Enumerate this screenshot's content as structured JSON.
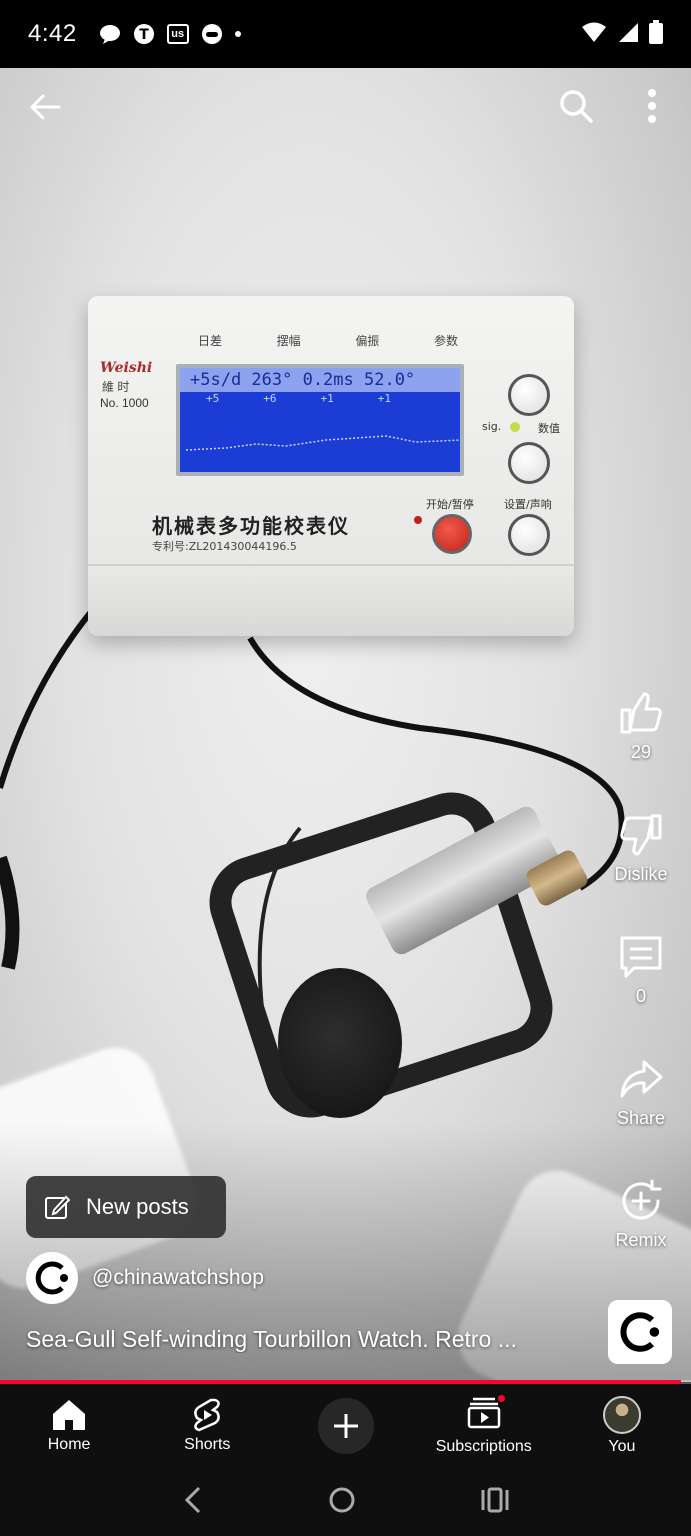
{
  "status_bar": {
    "time": "4:42",
    "carrier_badge": "T",
    "us_badge": "us"
  },
  "video": {
    "device": {
      "brand": "Weishi",
      "brand_cn": "維 时",
      "model": "No. 1000",
      "col_labels": [
        "日差",
        "摆幅",
        "偏振",
        "参数"
      ],
      "lcd_readout": "+5s/d 263° 0.2ms 52.0°",
      "lcd_sub": [
        "+5",
        "+6",
        "+1",
        "+1"
      ],
      "sig_label": "sig.",
      "value_label": "数值",
      "start_label": "开始/暂停",
      "settings_label": "设置/声响",
      "title": "机械表多功能校表仪",
      "patent": "专利号:ZL201430044196.5"
    }
  },
  "rail": {
    "like_count": "29",
    "dislike_label": "Dislike",
    "comments_count": "0",
    "share_label": "Share",
    "remix_label": "Remix"
  },
  "overlay": {
    "new_posts_label": "New posts",
    "channel_handle": "@chinawatchshop",
    "video_title": "Sea-Gull Self-winding Tourbillon Watch. Retro ..."
  },
  "progress": {
    "fraction": 0.985
  },
  "nav": {
    "items": [
      {
        "label": "Home",
        "icon": "home-icon"
      },
      {
        "label": "Shorts",
        "icon": "shorts-icon"
      },
      {
        "label": "",
        "icon": "create-icon"
      },
      {
        "label": "Subscriptions",
        "icon": "subscriptions-icon"
      },
      {
        "label": "You",
        "icon": "avatar"
      }
    ]
  },
  "colors": {
    "accent": "#ff0033",
    "nav_bg": "#0f0f0f"
  }
}
